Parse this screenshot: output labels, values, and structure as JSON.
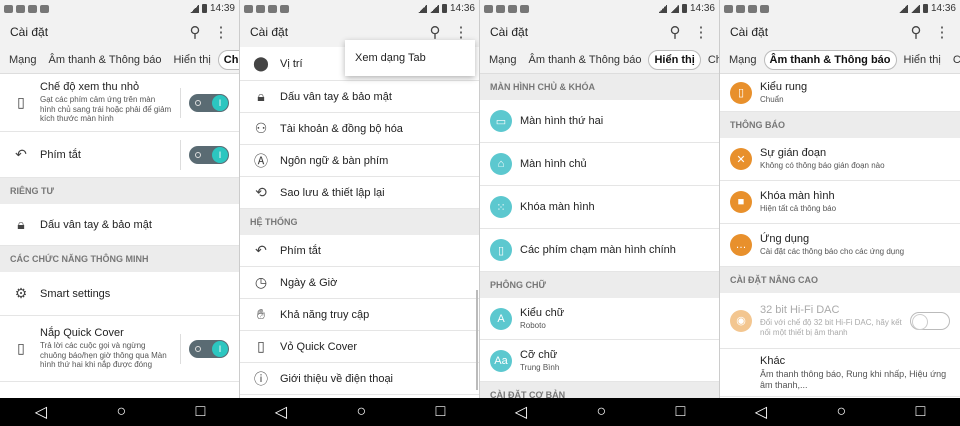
{
  "screen1": {
    "status_time": "14:39",
    "title": "Cài đặt",
    "tabs": [
      "Mạng",
      "Âm thanh & Thông báo",
      "Hiển thị",
      "Chung"
    ],
    "active_tab": "Chung",
    "rows": {
      "mini_view": {
        "label": "Chế độ xem thu nhỏ",
        "sub": "Gạt các phím cảm ứng trên màn hình chủ sang trái hoặc phải để giảm kích thước màn hình"
      },
      "shortcut": {
        "label": "Phím tắt"
      },
      "section_private": "RIÊNG TƯ",
      "fingerprint": {
        "label": "Dấu vân tay & bảo mật"
      },
      "section_smart": "CÁC CHỨC NĂNG THÔNG MINH",
      "smart": {
        "label": "Smart settings"
      },
      "quickcover": {
        "label": "Nắp Quick Cover",
        "sub": "Trả lời các cuộc gọi và ngừng chuông báo/hẹn giờ thông qua Màn hình thứ hai khi nắp được đóng"
      }
    }
  },
  "screen2": {
    "status_time": "14:36",
    "title": "Cài đặt",
    "popup": "Xem dạng Tab",
    "rows": {
      "location": "Vị trí",
      "fingerprint": "Dấu vân tay & bảo mật",
      "accounts": "Tài khoản & đồng bộ hóa",
      "language": "Ngôn ngữ & bàn phím",
      "backup": "Sao lưu & thiết lập lại",
      "section_system": "HỆ THỐNG",
      "shortcut": "Phím tắt",
      "datetime": "Ngày & Giờ",
      "access": "Khả năng truy cập",
      "quickcover": "Vỏ Quick Cover",
      "about": "Giới thiệu về điện thoại"
    }
  },
  "screen3": {
    "status_time": "14:36",
    "title": "Cài đặt",
    "tabs": [
      "Mạng",
      "Âm thanh & Thông báo",
      "Hiển thị",
      "Chung"
    ],
    "active_tab": "Hiển thị",
    "section_home": "MÀN HÌNH CHỦ & KHÓA",
    "rows": {
      "second": "Màn hình thứ hai",
      "home": "Màn hình chủ",
      "lock": "Khóa màn hình",
      "keys": "Các phím chạm màn hình chính"
    },
    "section_font": "PHÔNG CHỮ",
    "font_type": {
      "label": "Kiểu chữ",
      "sub": "Roboto"
    },
    "font_size": {
      "label": "Cỡ chữ",
      "sub": "Trung Bình"
    },
    "section_basic": "CÀI ĐẶT CƠ BẢN"
  },
  "screen4": {
    "status_time": "14:36",
    "title": "Cài đặt",
    "tabs": [
      "Mạng",
      "Âm thanh & Thông báo",
      "Hiển thị",
      "Chung"
    ],
    "active_tab": "Âm thanh & Thông báo",
    "vibrate": {
      "label": "Kiểu rung",
      "sub": "Chuẩn"
    },
    "section_notif": "THÔNG BÁO",
    "interrupt": {
      "label": "Sự gián đoạn",
      "sub": "Không có thông báo gián đoạn nào"
    },
    "lockscreen": {
      "label": "Khóa màn hình",
      "sub": "Hiện tất cả thông báo"
    },
    "apps": {
      "label": "Ứng dụng",
      "sub": "Cài đặt các thông báo cho các ứng dụng"
    },
    "section_adv": "CÀI ĐẶT NÂNG CAO",
    "hifi": {
      "label": "32 bit Hi-Fi DAC",
      "sub": "Đổi với chế độ 32 bit Hi-Fi DAC, hãy kết nối một thiết bị âm thanh"
    },
    "other": {
      "label": "Khác",
      "sub": "Âm thanh thông báo, Rung khi nhấp, Hiệu ứng âm thanh,..."
    }
  },
  "icons": [
    "search-icon",
    "more-vert-icon",
    "back-icon",
    "home-icon",
    "recents-icon"
  ],
  "colors": {
    "accent": "#2cc6c0",
    "teal_icon": "#5cc8cf",
    "orange_icon": "#e8902c"
  }
}
